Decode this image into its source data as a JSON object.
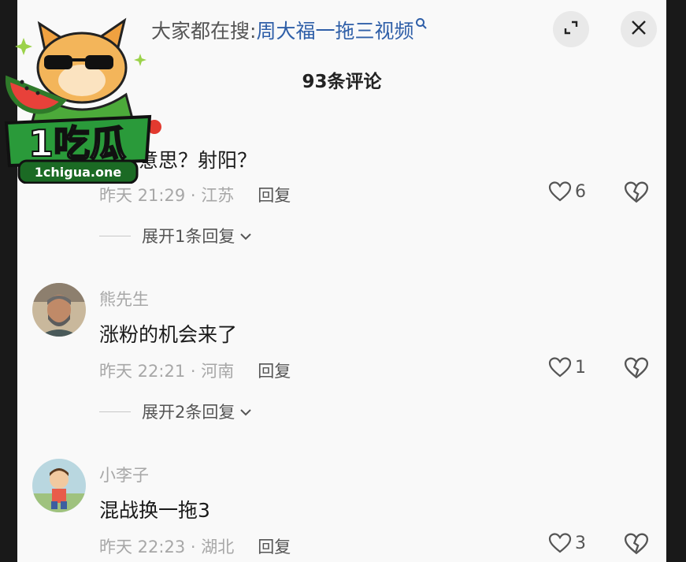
{
  "search": {
    "prefix": "大家都在搜:",
    "query": "周大福一拖三视频",
    "icon": "search-icon"
  },
  "header": {
    "title": "93条评论",
    "expand_icon": "expand-icon",
    "close_icon": "close-icon"
  },
  "logo": {
    "text": "1吃瓜",
    "url": "1chigua.one"
  },
  "comments": [
    {
      "username": "",
      "text": "什么意思？射阳？",
      "time": "昨天 21:29 · 江苏",
      "reply": "回复",
      "likes": "6",
      "expand": "展开1条回复"
    },
    {
      "username": "熊先生",
      "text": "涨粉的机会来了",
      "time": "昨天 22:21 · 河南",
      "reply": "回复",
      "likes": "1",
      "expand": "展开2条回复"
    },
    {
      "username": "小李子",
      "text": "混战换一拖3",
      "time": "昨天 22:23 · 湖北",
      "reply": "回复",
      "likes": "3"
    }
  ],
  "colors": {
    "background": "#f9f9f9",
    "frame": "#191919",
    "link": "#2f5fa8",
    "muted": "#a7a7a7"
  }
}
